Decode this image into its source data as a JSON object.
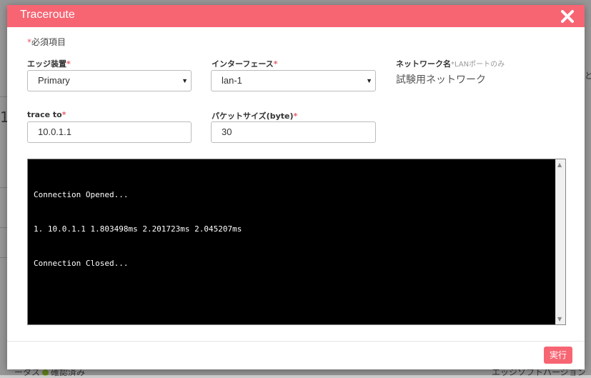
{
  "background": {
    "status_label": "ータス",
    "status_value": "確認済み",
    "software_label": "エッジソフトバージョン",
    "fragment_left": "1",
    "fragment_right": "と"
  },
  "modal": {
    "title": "Traceroute",
    "required_note": "必須項目",
    "required_mark": "*",
    "fields": {
      "edge_device": {
        "label": "エッジ装置",
        "value": "Primary"
      },
      "interface": {
        "label": "インターフェース",
        "value": "lan-1"
      },
      "network_name": {
        "label": "ネットワーク名",
        "sublabel": "*LANポートのみ",
        "value": "試験用ネットワーク"
      },
      "trace_to": {
        "label": "trace to",
        "value": "10.0.1.1"
      },
      "packet_size": {
        "label": "パケットサイズ(byte)",
        "value": "30"
      }
    },
    "console": {
      "lines": [
        "Connection Opened...",
        "1. 10.0.1.1 1.803498ms 2.201723ms 2.045207ms",
        "Connection Closed..."
      ]
    },
    "execute_label": "実行"
  },
  "colors": {
    "accent": "#f76573",
    "console_bg": "#000000"
  },
  "icons": {
    "close": "close-icon",
    "dropdown": "chevron-down-icon"
  }
}
